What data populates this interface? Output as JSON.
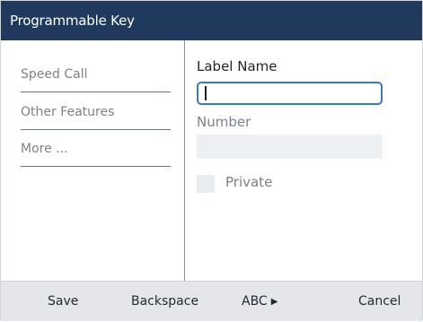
{
  "window": {
    "title": "Programmable Key"
  },
  "sidebar": {
    "items": [
      {
        "label": "Speed Call"
      },
      {
        "label": "Other Features"
      },
      {
        "label": "More ..."
      }
    ]
  },
  "form": {
    "label_name": {
      "label": "Label Name",
      "value": ""
    },
    "number": {
      "label": "Number",
      "value": ""
    },
    "private": {
      "label": "Private",
      "checked": false
    }
  },
  "softkeys": {
    "save": "Save",
    "backspace": "Backspace",
    "abc": "ABC",
    "cancel": "Cancel"
  },
  "colors": {
    "titlebar": "#1f3a5c",
    "focus": "#3a78c4",
    "softkey_bar": "#e4e6e9"
  },
  "icons": {
    "abc_arrow": "play-arrow-icon"
  }
}
